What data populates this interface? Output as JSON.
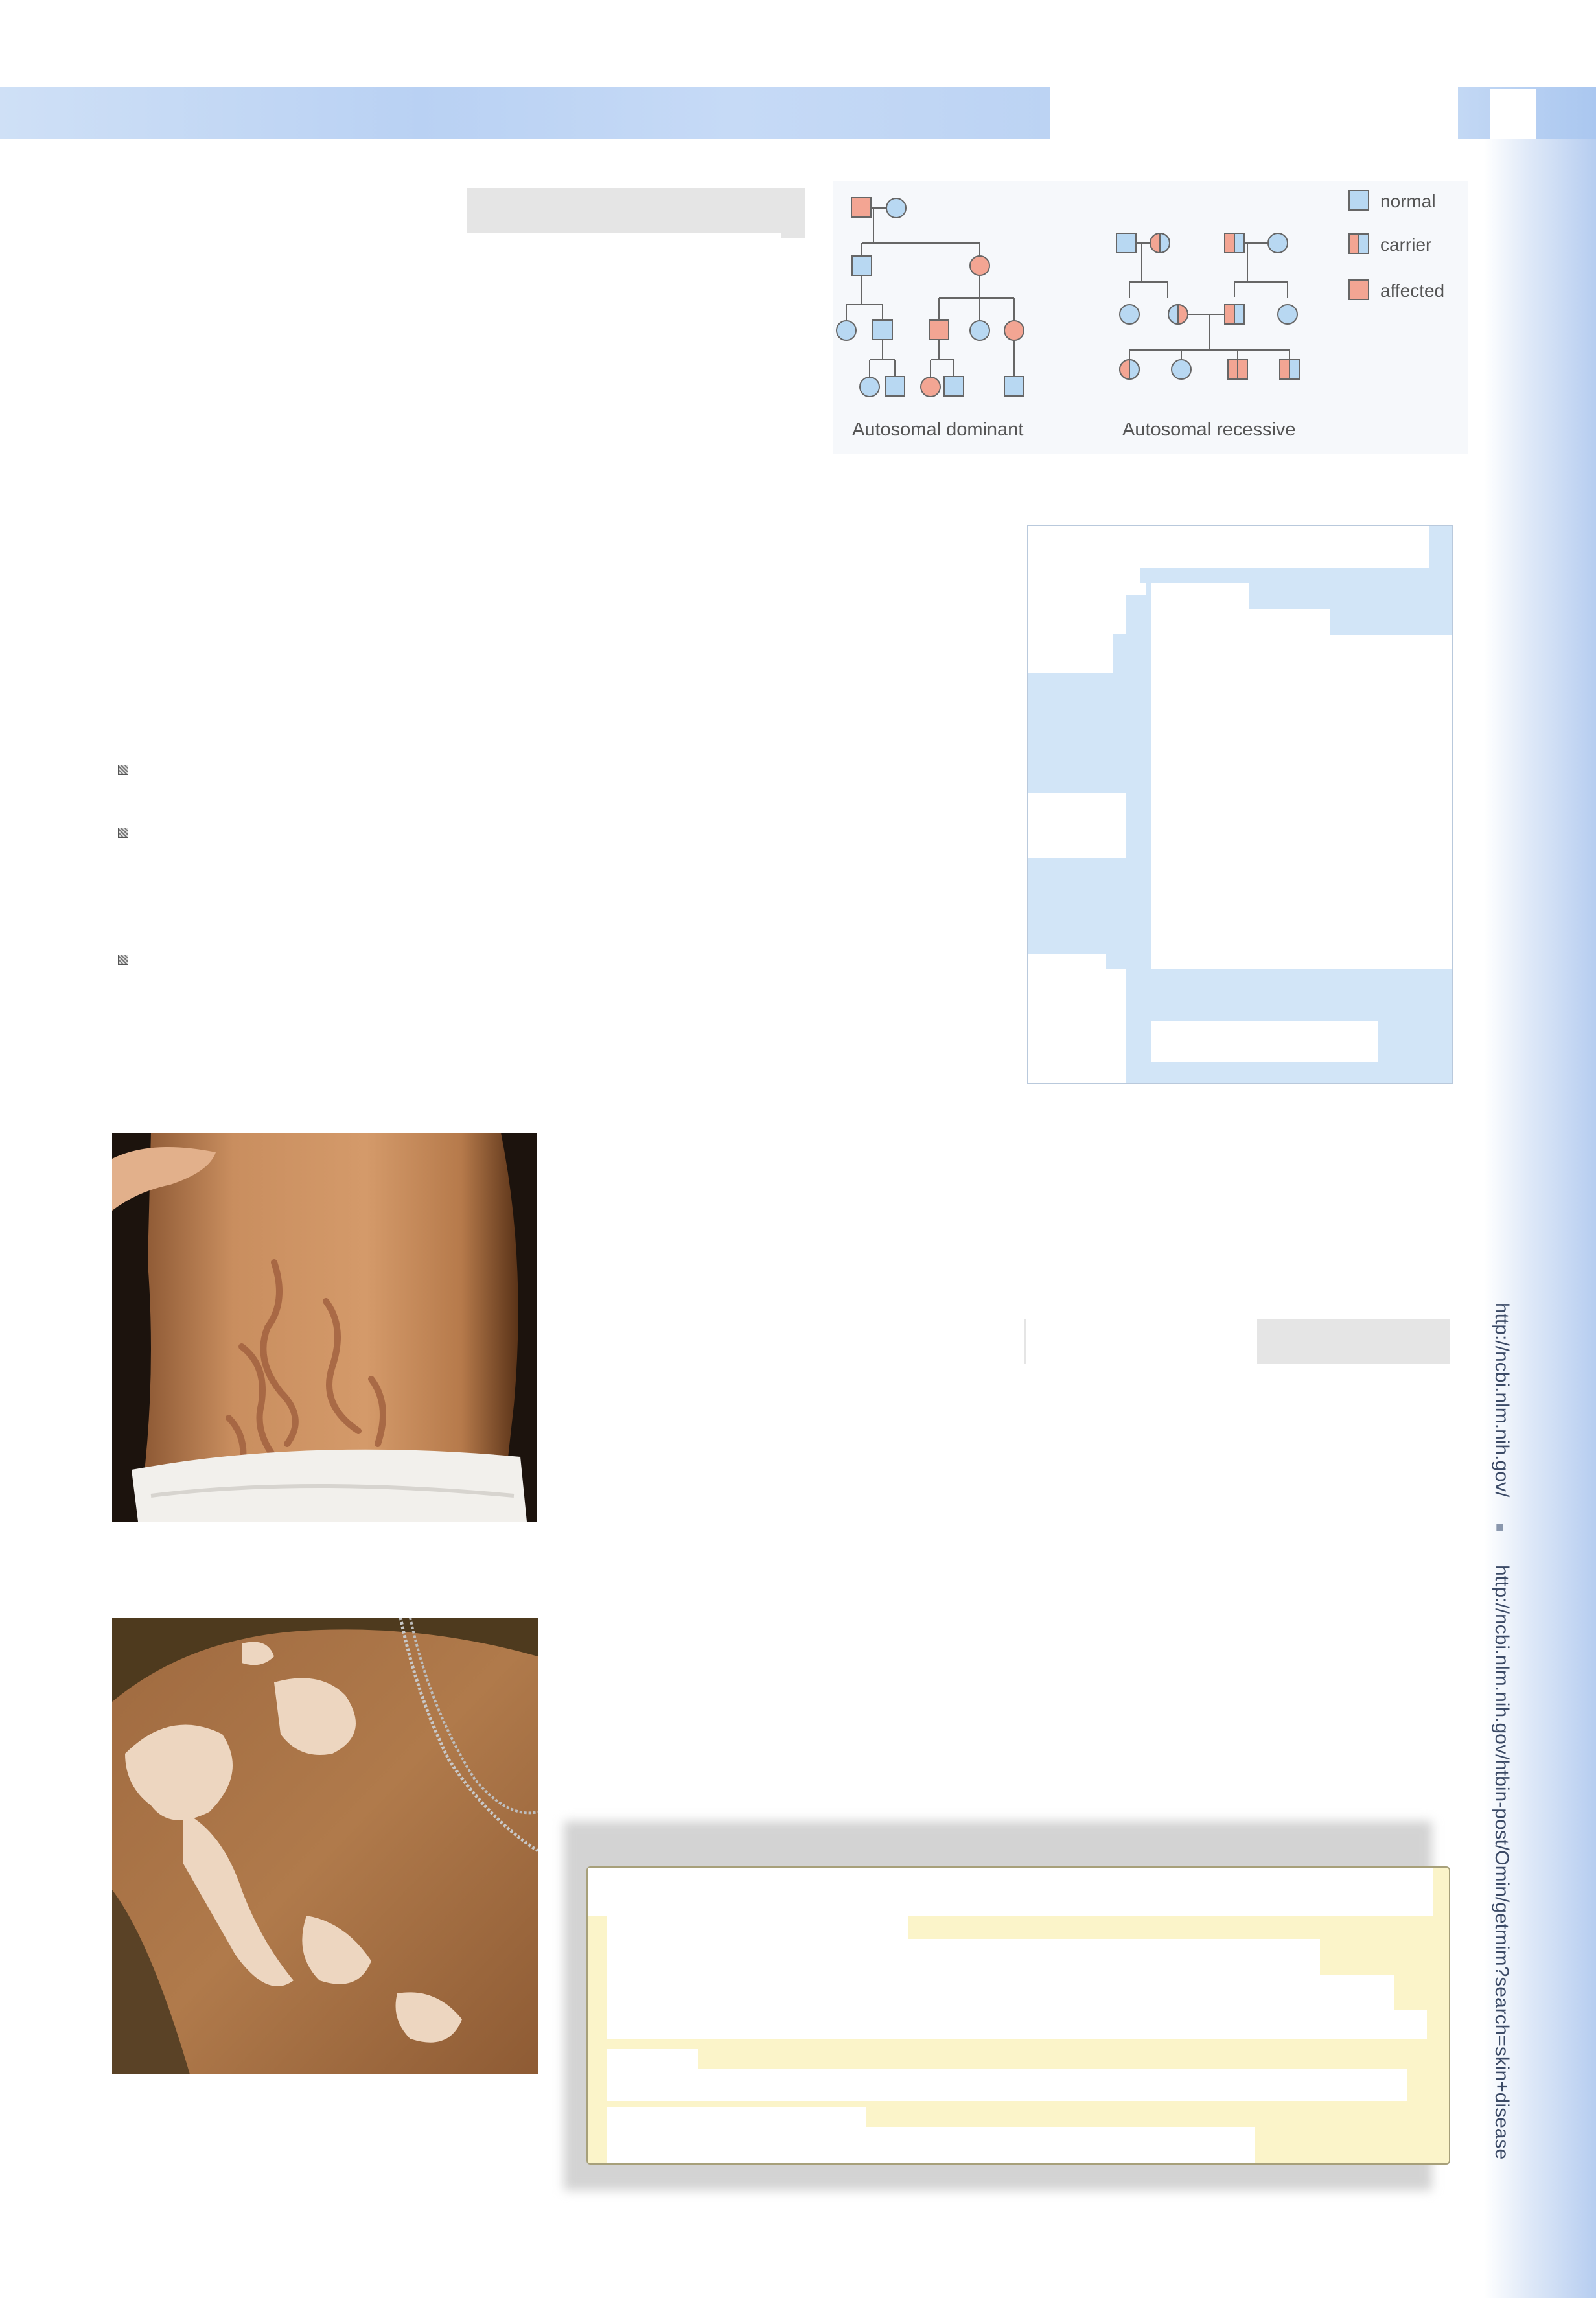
{
  "pedigree": {
    "legend": [
      {
        "label": "normal",
        "status": "normal"
      },
      {
        "label": "carrier",
        "status": "carrier"
      },
      {
        "label": "affected",
        "status": "affected"
      }
    ],
    "captions": {
      "dominant": "Autosomal dominant",
      "recessive": "Autosomal recessive"
    },
    "colors": {
      "normal": "#b8d8f2",
      "affected": "#f3a593",
      "line": "#666666"
    }
  },
  "side_links": {
    "url_1": "http://ncbi.nlm.nih.gov/",
    "separator": "■",
    "url_2": "http://ncbi.nlm.nih.gov/htbin-post/Omin/getmim?search=skin+disease"
  }
}
